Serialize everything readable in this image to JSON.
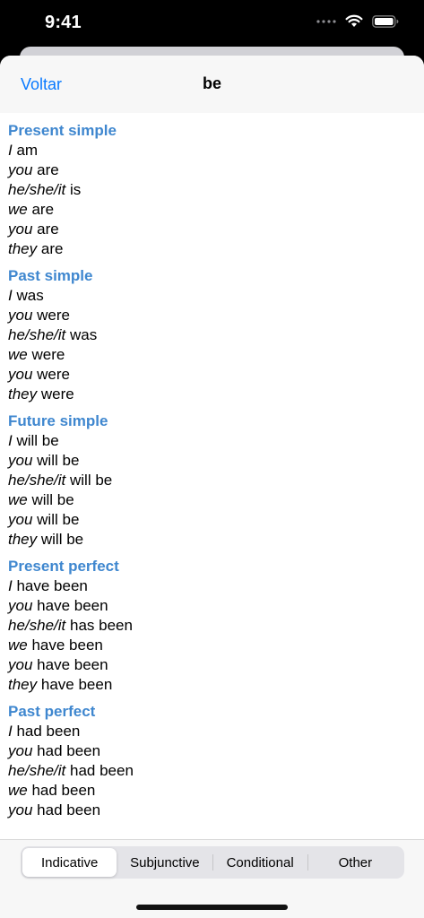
{
  "status_bar": {
    "time": "9:41"
  },
  "nav": {
    "back_label": "Voltar",
    "title": "be"
  },
  "sections": [
    {
      "title": "Present simple",
      "forms": [
        {
          "pronoun": "I",
          "verb": "am"
        },
        {
          "pronoun": "you",
          "verb": "are"
        },
        {
          "pronoun": "he/she/it",
          "verb": "is"
        },
        {
          "pronoun": "we",
          "verb": "are"
        },
        {
          "pronoun": "you",
          "verb": "are"
        },
        {
          "pronoun": "they",
          "verb": "are"
        }
      ]
    },
    {
      "title": "Past simple",
      "forms": [
        {
          "pronoun": "I",
          "verb": "was"
        },
        {
          "pronoun": "you",
          "verb": "were"
        },
        {
          "pronoun": "he/she/it",
          "verb": "was"
        },
        {
          "pronoun": "we",
          "verb": "were"
        },
        {
          "pronoun": "you",
          "verb": "were"
        },
        {
          "pronoun": "they",
          "verb": "were"
        }
      ]
    },
    {
      "title": "Future simple",
      "forms": [
        {
          "pronoun": "I",
          "verb": "will be"
        },
        {
          "pronoun": "you",
          "verb": "will be"
        },
        {
          "pronoun": "he/she/it",
          "verb": "will be"
        },
        {
          "pronoun": "we",
          "verb": "will be"
        },
        {
          "pronoun": "you",
          "verb": "will be"
        },
        {
          "pronoun": "they",
          "verb": "will be"
        }
      ]
    },
    {
      "title": "Present perfect",
      "forms": [
        {
          "pronoun": "I",
          "verb": "have been"
        },
        {
          "pronoun": "you",
          "verb": "have been"
        },
        {
          "pronoun": "he/she/it",
          "verb": "has been"
        },
        {
          "pronoun": "we",
          "verb": "have been"
        },
        {
          "pronoun": "you",
          "verb": "have been"
        },
        {
          "pronoun": "they",
          "verb": "have been"
        }
      ]
    },
    {
      "title": "Past perfect",
      "forms": [
        {
          "pronoun": "I",
          "verb": "had been"
        },
        {
          "pronoun": "you",
          "verb": "had been"
        },
        {
          "pronoun": "he/she/it",
          "verb": "had been"
        },
        {
          "pronoun": "we",
          "verb": "had been"
        },
        {
          "pronoun": "you",
          "verb": "had been"
        }
      ]
    }
  ],
  "tabs": [
    {
      "label": "Indicative",
      "selected": true
    },
    {
      "label": "Subjunctive",
      "selected": false
    },
    {
      "label": "Conditional",
      "selected": false
    },
    {
      "label": "Other",
      "selected": false
    }
  ],
  "colors": {
    "accent": "#0a7aff",
    "section_title": "#3f87cf"
  },
  "icons": [
    "cellular-signal-icon",
    "wifi-icon",
    "battery-icon"
  ]
}
